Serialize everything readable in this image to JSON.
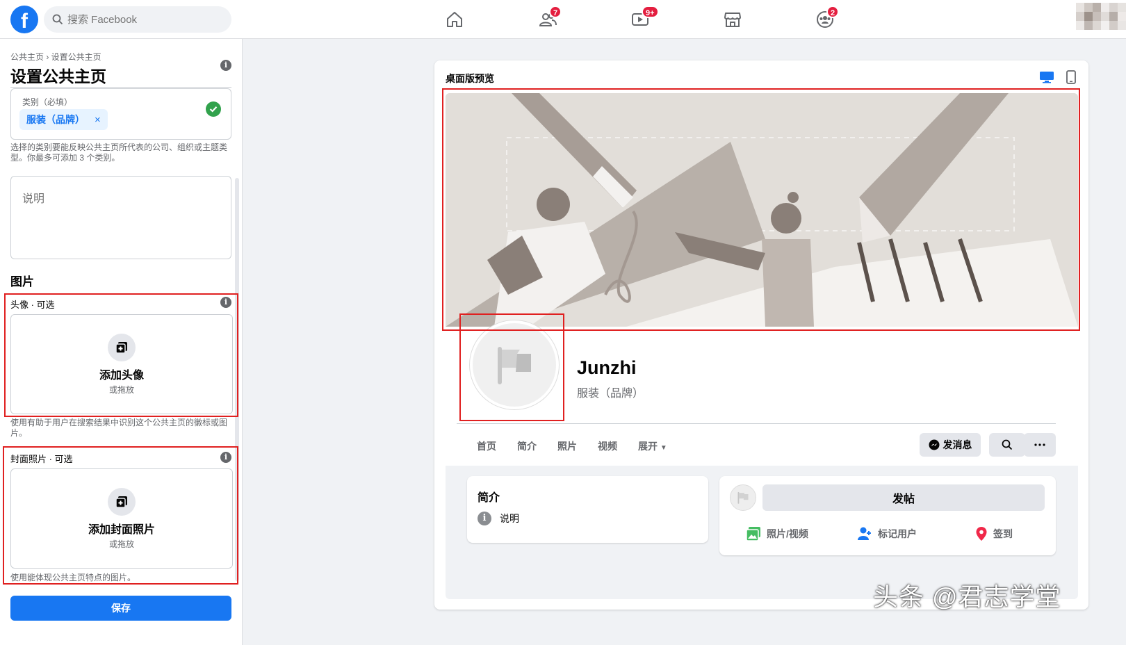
{
  "topbar": {
    "logo": "f",
    "search_placeholder": "搜索 Facebook",
    "nav": [
      {
        "icon": "home-icon",
        "badge": ""
      },
      {
        "icon": "friends-icon",
        "badge": "7"
      },
      {
        "icon": "watch-icon",
        "badge": "9+"
      },
      {
        "icon": "marketplace-icon",
        "badge": ""
      },
      {
        "icon": "groups-icon",
        "badge": "2"
      }
    ]
  },
  "left": {
    "breadcrumb": "公共主页 › 设置公共主页",
    "title": "设置公共主页",
    "category_label": "类别（必填）",
    "category_chip": "服装（品牌）",
    "chip_remove": "×",
    "category_help": "选择的类别要能反映公共主页所代表的公司、组织或主题类型。你最多可添加 3 个类别。",
    "description_placeholder": "说明",
    "images_heading": "图片",
    "avatar_label": "头像 · 可选",
    "avatar_upload_title": "添加头像",
    "avatar_upload_sub": "或拖放",
    "avatar_help": "使用有助于用户在搜索结果中识别这个公共主页的徽标或图片。",
    "cover_label": "封面照片 · 可选",
    "cover_upload_title": "添加封面照片",
    "cover_upload_sub": "或拖放",
    "cover_help": "使用能体现公共主页特点的图片。",
    "save": "保存"
  },
  "preview": {
    "title": "桌面版预览",
    "page_name": "Junzhi",
    "page_category": "服装（品牌）",
    "tabs": [
      "首页",
      "简介",
      "照片",
      "视频",
      "展开"
    ],
    "message_btn": "发消息",
    "about_heading": "简介",
    "about_desc": "说明",
    "post_btn": "发帖",
    "actions": [
      "照片/视频",
      "标记用户",
      "签到"
    ]
  },
  "watermark": "头条 @君志学堂",
  "colors": {
    "accent": "#1877f2",
    "badge": "#e41e3f",
    "highlight": "#e02020",
    "success": "#31a24c"
  }
}
